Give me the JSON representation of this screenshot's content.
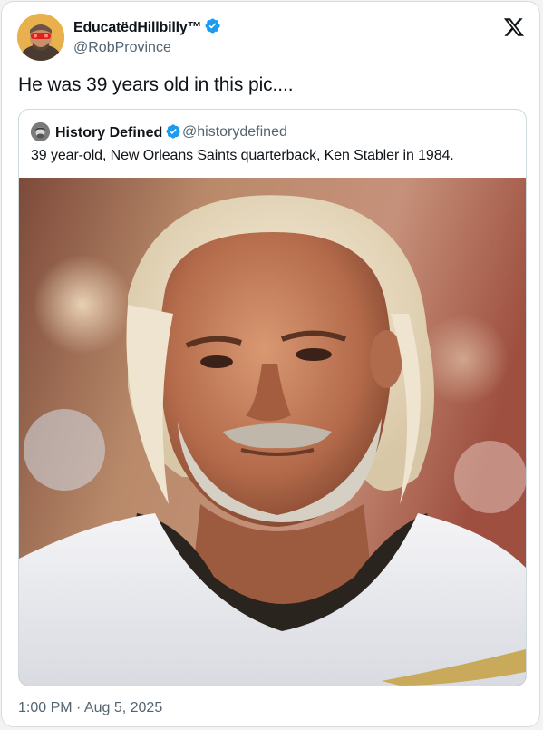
{
  "tweet": {
    "author_name": "EducatëdHillbilly™",
    "author_handle": "@RobProvince",
    "text": "He was 39 years old in this pic....",
    "timestamp": "1:00 PM · Aug 5, 2025"
  },
  "quoted_tweet": {
    "author_name": "History Defined",
    "author_handle": "@historydefined",
    "text": "39 year-old, New Orleans Saints quarterback, Ken Stabler in 1984."
  },
  "icons": {
    "verified": "verified-badge-icon",
    "platform": "x-logo-icon"
  },
  "colors": {
    "verified_blue": "#1d9bf0",
    "secondary_text": "#536471",
    "border": "#cfd9de"
  }
}
